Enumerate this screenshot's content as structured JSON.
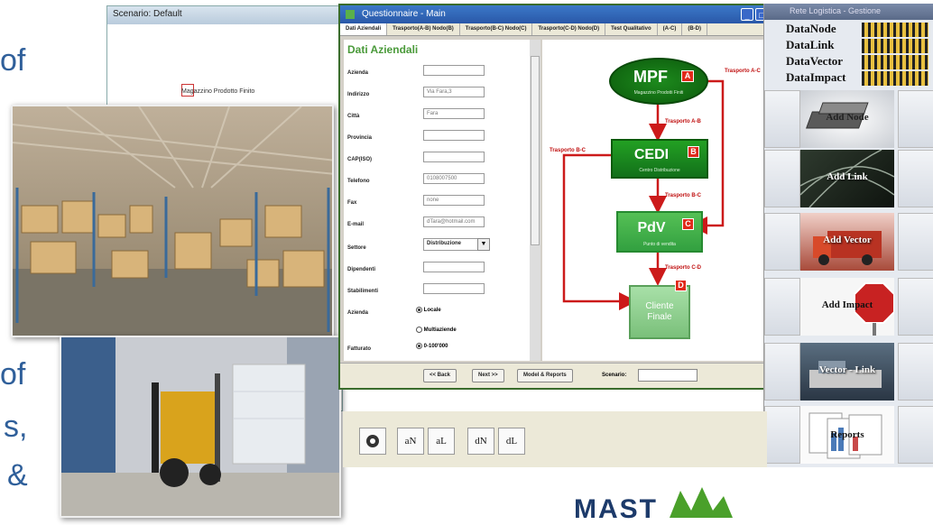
{
  "slide": {
    "text_of_1": "of",
    "text_of_2": "of",
    "text_s": "s,",
    "text_amp": "&"
  },
  "scenario_window": {
    "title": "Scenario: Default",
    "node_label": "Magazzino Prodotto Finito"
  },
  "questionnaire": {
    "title": "Questionnaire - Main",
    "tabs": [
      "Dati Aziendali",
      "Trasporto(A-B) Nodo(B)",
      "Trasporto(B-C) Nodo(C)",
      "Trasporto(C-D) Nodo(D)",
      "Test Qualitativo",
      "(A-C)",
      "(B-D)"
    ],
    "form_heading": "Dati Aziendali",
    "fields": [
      {
        "label": "Azienda",
        "value": ""
      },
      {
        "label": "Indirizzo",
        "value": "Via Fara,3"
      },
      {
        "label": "Città",
        "value": "Fara"
      },
      {
        "label": "Provincia",
        "value": ""
      },
      {
        "label": "CAP(ISO)",
        "value": ""
      },
      {
        "label": "Telefono",
        "value": "0108007500"
      },
      {
        "label": "Fax",
        "value": "none"
      },
      {
        "label": "E-mail",
        "value": "dTara@hotmail.com"
      },
      {
        "label": "Settore",
        "value": "Distribuzione"
      },
      {
        "label": "Dipendenti",
        "value": ""
      },
      {
        "label": "Stabilimenti",
        "value": ""
      }
    ],
    "radio_label": "Azienda",
    "radio_options": [
      "Locale",
      "Multiaziende"
    ],
    "fatturato_label": "Fatturato",
    "fatturato_value": "0-100'000",
    "buttons": {
      "back": "<< Back",
      "next": "Next >>",
      "model": "Model & Reports"
    },
    "scenario_label": "Scenario:",
    "diagram": {
      "nodes": [
        {
          "title": "MPF",
          "badge": "A",
          "subtitle": "Magazzino Prodotti Finiti"
        },
        {
          "title": "CEDI",
          "badge": "B",
          "subtitle": "Centro Distribuzione"
        },
        {
          "title": "PdV",
          "badge": "C",
          "subtitle": "Punto di vendita"
        },
        {
          "title": "Cliente Finale",
          "badge": "D",
          "subtitle": ""
        }
      ],
      "links": [
        "Trasporto A-B",
        "Trasporto B-C",
        "Trasporto C-D",
        "Trasporto A-C",
        "Trasporto B-C"
      ]
    }
  },
  "logistics_window": {
    "title": "Rete Logistica - Gestione",
    "data_items": [
      "DataNode",
      "DataLink",
      "DataVector",
      "DataImpact"
    ],
    "actions": [
      "Add Node",
      "Add Link",
      "Add Vector",
      "Add Impact",
      "Vector - Link",
      "Reports"
    ]
  },
  "toolbar": {
    "buttons": [
      "aN",
      "aL",
      "dN",
      "dL"
    ]
  },
  "footer_logo": "MAST"
}
